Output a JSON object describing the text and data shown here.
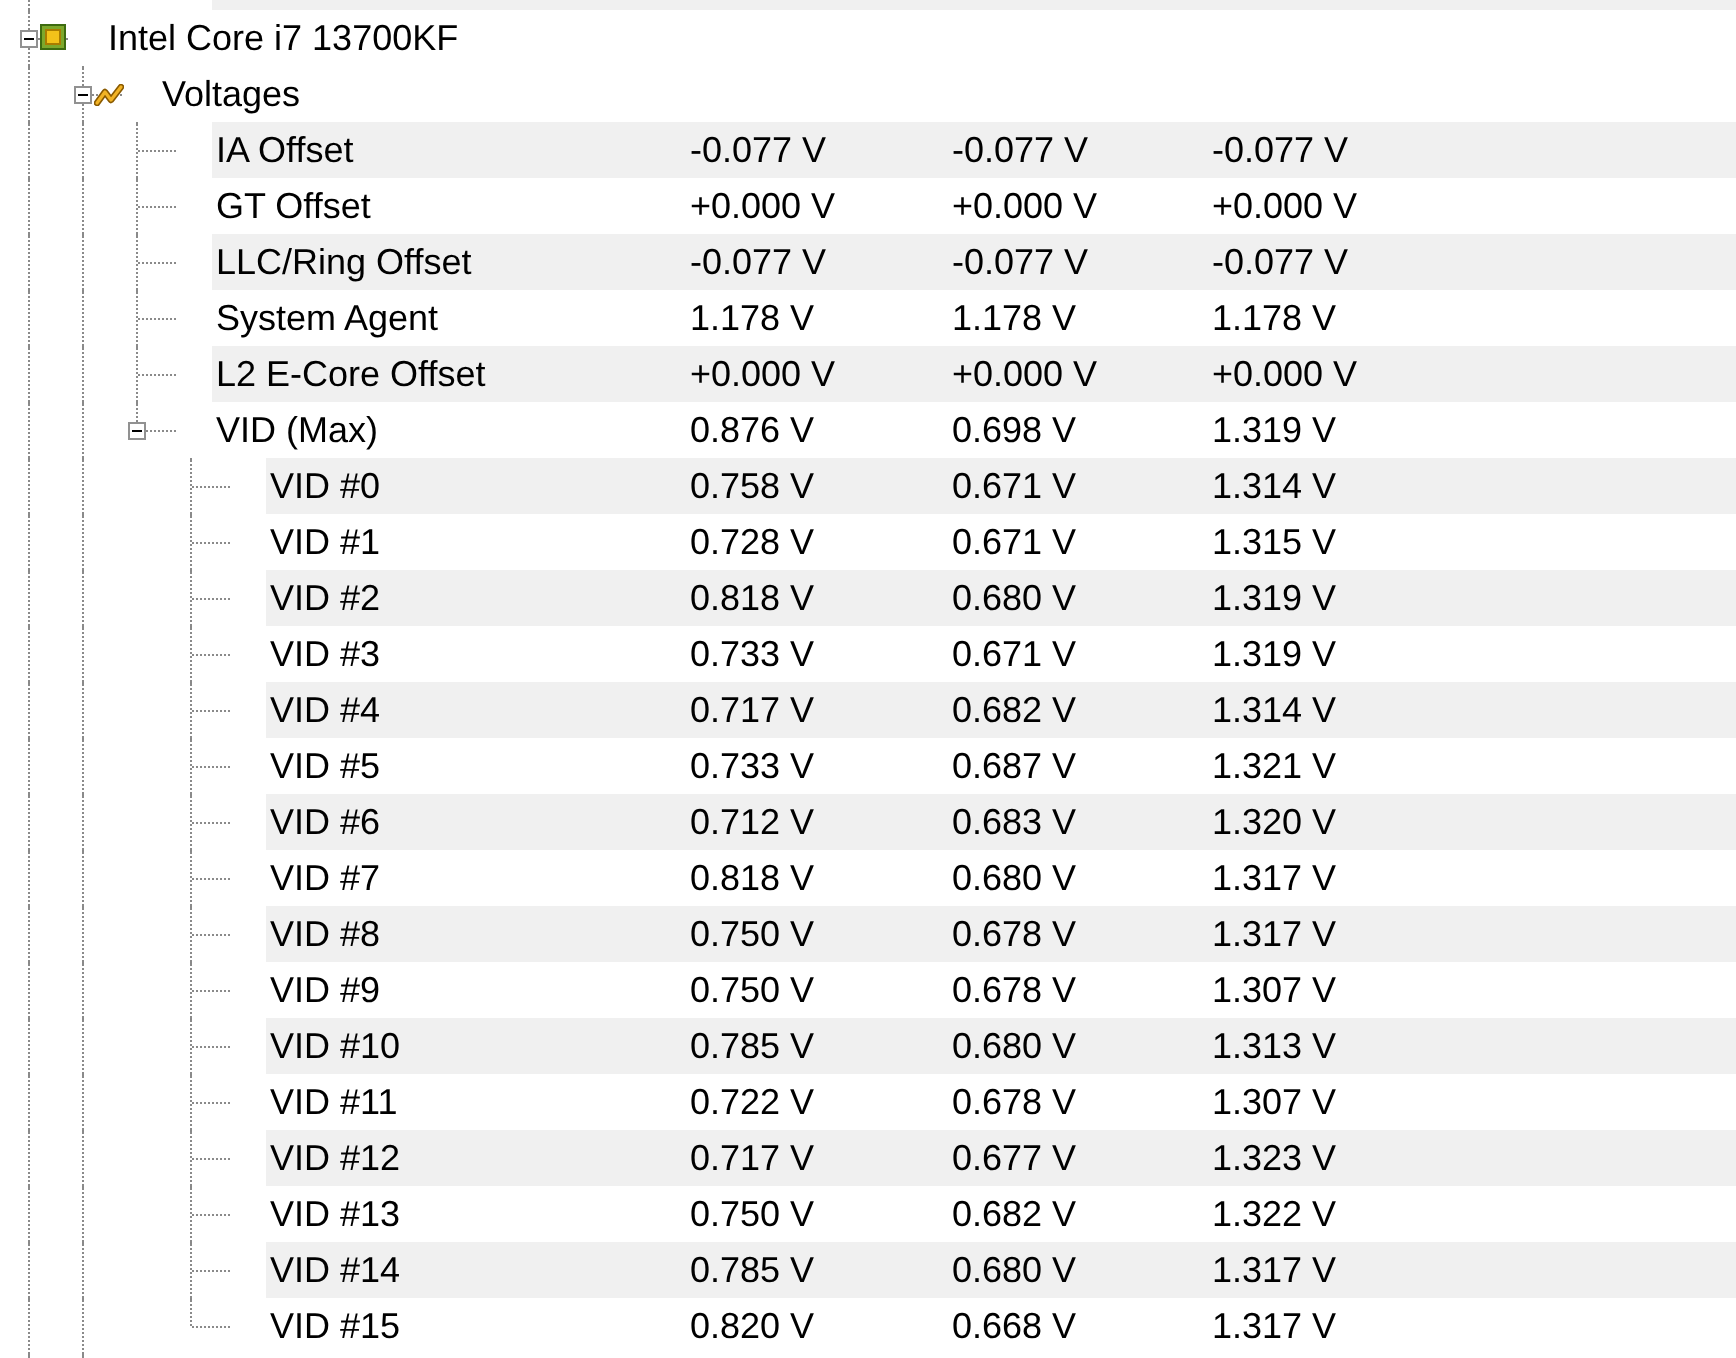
{
  "tree": [
    {
      "label": "Intel Core i7 13700KF",
      "kind": "device",
      "expanded": true,
      "children": [
        {
          "label": "Voltages",
          "kind": "group",
          "expanded": true,
          "children": [
            {
              "label": "IA Offset",
              "values": [
                "-0.077 V",
                "-0.077 V",
                "-0.077 V"
              ]
            },
            {
              "label": "GT Offset",
              "values": [
                "+0.000 V",
                "+0.000 V",
                "+0.000 V"
              ]
            },
            {
              "label": "LLC/Ring Offset",
              "values": [
                "-0.077 V",
                "-0.077 V",
                "-0.077 V"
              ]
            },
            {
              "label": "System Agent",
              "values": [
                "1.178 V",
                "1.178 V",
                "1.178 V"
              ]
            },
            {
              "label": "L2 E-Core Offset",
              "values": [
                "+0.000 V",
                "+0.000 V",
                "+0.000 V"
              ]
            },
            {
              "label": "VID (Max)",
              "expanded": true,
              "values": [
                "0.876 V",
                "0.698 V",
                "1.319 V"
              ],
              "children": [
                {
                  "label": "VID #0",
                  "values": [
                    "0.758 V",
                    "0.671 V",
                    "1.314 V"
                  ]
                },
                {
                  "label": "VID #1",
                  "values": [
                    "0.728 V",
                    "0.671 V",
                    "1.315 V"
                  ]
                },
                {
                  "label": "VID #2",
                  "values": [
                    "0.818 V",
                    "0.680 V",
                    "1.319 V"
                  ]
                },
                {
                  "label": "VID #3",
                  "values": [
                    "0.733 V",
                    "0.671 V",
                    "1.319 V"
                  ]
                },
                {
                  "label": "VID #4",
                  "values": [
                    "0.717 V",
                    "0.682 V",
                    "1.314 V"
                  ]
                },
                {
                  "label": "VID #5",
                  "values": [
                    "0.733 V",
                    "0.687 V",
                    "1.321 V"
                  ]
                },
                {
                  "label": "VID #6",
                  "values": [
                    "0.712 V",
                    "0.683 V",
                    "1.320 V"
                  ]
                },
                {
                  "label": "VID #7",
                  "values": [
                    "0.818 V",
                    "0.680 V",
                    "1.317 V"
                  ]
                },
                {
                  "label": "VID #8",
                  "values": [
                    "0.750 V",
                    "0.678 V",
                    "1.317 V"
                  ]
                },
                {
                  "label": "VID #9",
                  "values": [
                    "0.750 V",
                    "0.678 V",
                    "1.307 V"
                  ]
                },
                {
                  "label": "VID #10",
                  "values": [
                    "0.785 V",
                    "0.680 V",
                    "1.313 V"
                  ]
                },
                {
                  "label": "VID #11",
                  "values": [
                    "0.722 V",
                    "0.678 V",
                    "1.307 V"
                  ]
                },
                {
                  "label": "VID #12",
                  "values": [
                    "0.717 V",
                    "0.677 V",
                    "1.323 V"
                  ]
                },
                {
                  "label": "VID #13",
                  "values": [
                    "0.750 V",
                    "0.682 V",
                    "1.322 V"
                  ]
                },
                {
                  "label": "VID #14",
                  "values": [
                    "0.785 V",
                    "0.680 V",
                    "1.317 V"
                  ]
                },
                {
                  "label": "VID #15",
                  "values": [
                    "0.820 V",
                    "0.668 V",
                    "1.317 V"
                  ]
                }
              ]
            }
          ]
        }
      ]
    }
  ]
}
